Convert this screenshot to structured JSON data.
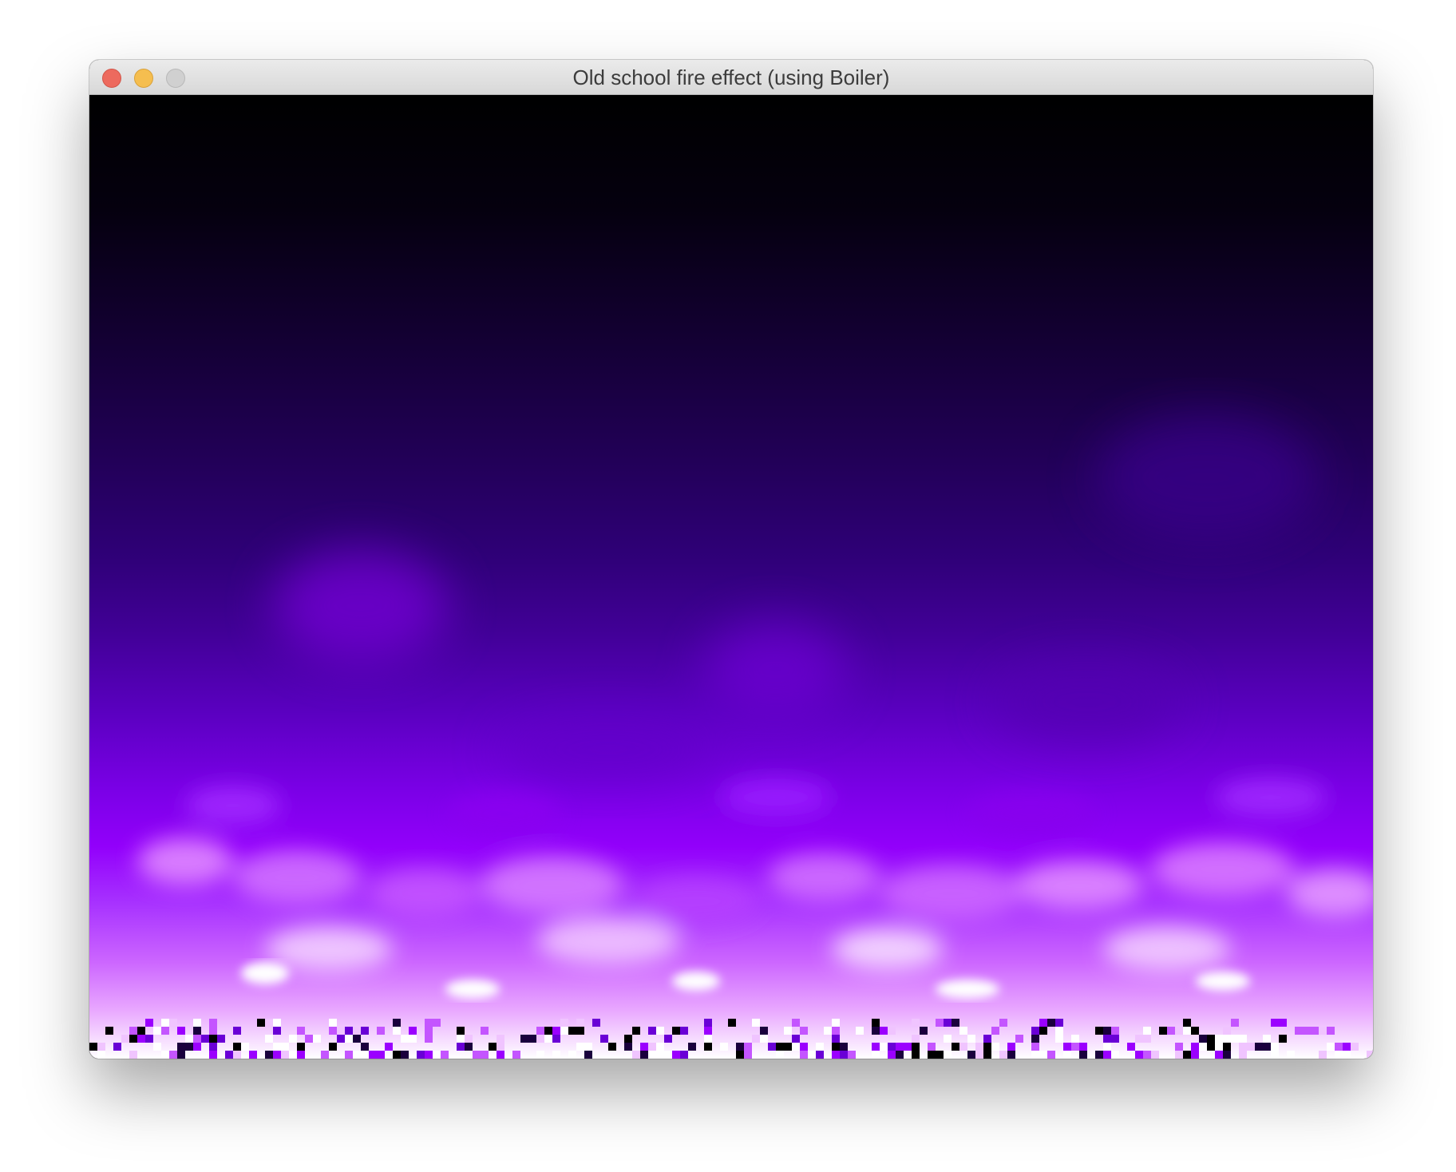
{
  "window": {
    "title": "Old school fire effect (using Boiler)"
  },
  "controls": {
    "close": "close-icon",
    "minimize": "minimize-icon",
    "zoom": "zoom-icon"
  },
  "colors": {
    "close": "#ed6a5e",
    "minimize": "#f5be4f",
    "zoom_disabled": "#d0d0d0",
    "fire_dark": "#000000",
    "fire_mid": "#2d006b",
    "fire_bright": "#9b00ff",
    "fire_hot": "#ffffff"
  }
}
